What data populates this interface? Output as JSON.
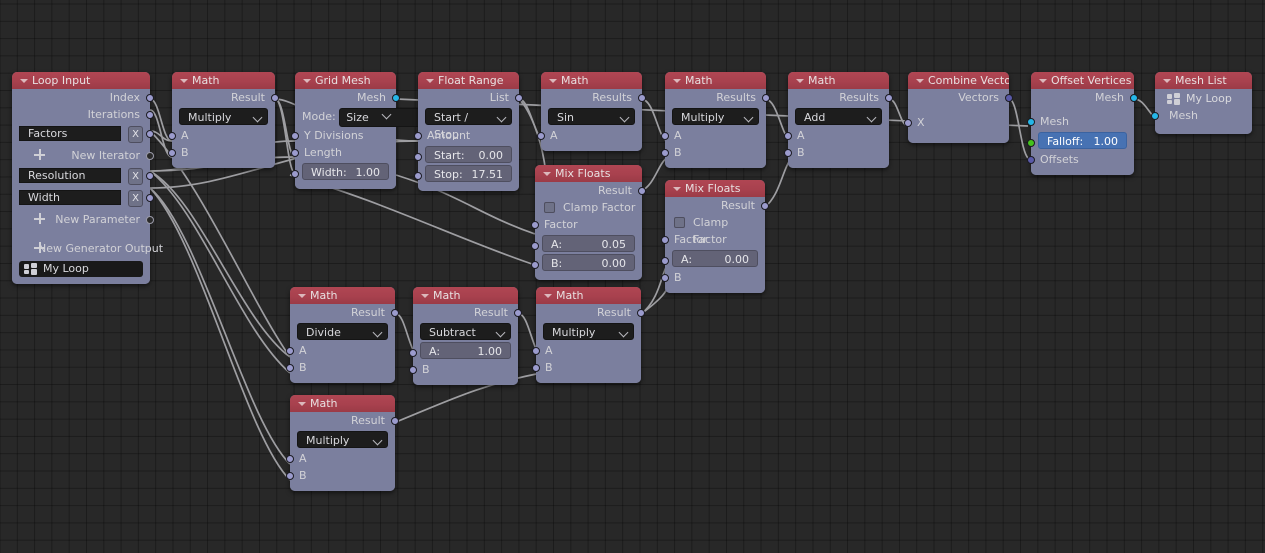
{
  "editor": {
    "name": "node-editor",
    "background_color": "#282828",
    "grid_color": "#1f1f1f",
    "node_body_color": "#7b7f9e",
    "node_header_color": "#a8414e",
    "socket_color": "#9b9bcd",
    "geometry_socket_color": "#25b6e8",
    "float_socket_color": "#43c21c",
    "vector_socket_color": "#5a5aa8",
    "active_field_color": "#4772b3"
  },
  "nodes": [
    {
      "id": "loop-input",
      "title": "Loop Input",
      "outputs": [
        "Index",
        "Iterations"
      ],
      "params": [
        {
          "name": "Factors",
          "remove_label": "X"
        },
        {
          "name": "Resolution",
          "remove_label": "X"
        },
        {
          "name": "Width",
          "remove_label": "X"
        }
      ],
      "new_iterator_label": "New Iterator",
      "new_parameter_label": "New Parameter",
      "new_generator_output_label": "New Generator Output",
      "loop_name": "My Loop"
    },
    {
      "id": "math-multiply-1",
      "title": "Math",
      "output_label": "Result",
      "operation": "Multiply",
      "inputs": [
        "A",
        "B"
      ]
    },
    {
      "id": "grid-mesh",
      "title": "Grid Mesh",
      "output_label": "Mesh",
      "mode_label": "Mode:",
      "mode_value": "Size",
      "inputs": [
        "Y Divisions",
        "Length"
      ],
      "width_label": "Width:",
      "width_value": "1.00"
    },
    {
      "id": "float-range",
      "title": "Float Range",
      "output_label": "List",
      "mode_value": "Start / Stop",
      "amount_label": "Amount",
      "start_label": "Start:",
      "start_value": "0.00",
      "stop_label": "Stop:",
      "stop_value": "17.51"
    },
    {
      "id": "math-sin",
      "title": "Math",
      "output_label": "Results",
      "operation": "Sin",
      "inputs": [
        "A"
      ]
    },
    {
      "id": "mix-floats-1",
      "title": "Mix Floats",
      "output_label": "Result",
      "clamp_label": "Clamp Factor",
      "factor_label": "Factor",
      "a_label": "A:",
      "a_value": "0.05",
      "b_label": "B:",
      "b_value": "0.00"
    },
    {
      "id": "math-multiply-2",
      "title": "Math",
      "output_label": "Results",
      "operation": "Multiply",
      "inputs": [
        "A",
        "B"
      ]
    },
    {
      "id": "mix-floats-2",
      "title": "Mix Floats",
      "output_label": "Result",
      "clamp_label": "Clamp Factor",
      "factor_label": "Factor",
      "a_label": "A:",
      "a_value": "0.00",
      "b_label": "B"
    },
    {
      "id": "math-add",
      "title": "Math",
      "output_label": "Results",
      "operation": "Add",
      "inputs": [
        "A",
        "B"
      ]
    },
    {
      "id": "combine-vector",
      "title": "Combine Vector",
      "output_label": "Vectors",
      "inputs": [
        "X"
      ]
    },
    {
      "id": "offset-vertices",
      "title": "Offset Vertices",
      "output_label": "Mesh",
      "mesh_input_label": "Mesh",
      "falloff_label": "Falloff:",
      "falloff_value": "1.00",
      "offsets_label": "Offsets"
    },
    {
      "id": "mesh-list",
      "title": "Mesh List",
      "loop_name": "My Loop",
      "input_label": "Mesh"
    },
    {
      "id": "math-divide",
      "title": "Math",
      "output_label": "Result",
      "operation": "Divide",
      "inputs": [
        "A",
        "B"
      ]
    },
    {
      "id": "math-subtract",
      "title": "Math",
      "output_label": "Result",
      "operation": "Subtract",
      "a_label": "A:",
      "a_value": "1.00",
      "b_label": "B"
    },
    {
      "id": "math-multiply-3",
      "title": "Math",
      "output_label": "Result",
      "operation": "Multiply",
      "inputs": [
        "A",
        "B"
      ]
    },
    {
      "id": "math-multiply-4",
      "title": "Math",
      "output_label": "Result",
      "operation": "Multiply",
      "inputs": [
        "A",
        "B"
      ]
    }
  ]
}
